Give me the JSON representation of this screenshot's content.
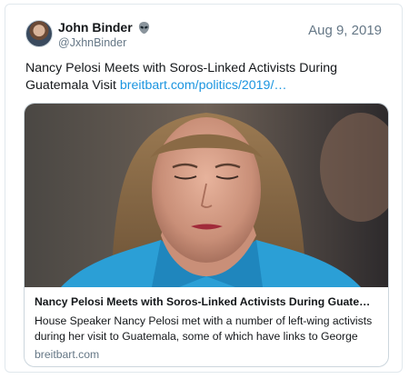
{
  "tweet": {
    "author_name": "John Binder",
    "author_handle": "@JxhnBinder",
    "date": "Aug 9, 2019",
    "text": "Nancy Pelosi Meets with Soros-Linked Activists During Guatemala Visit",
    "link_text": "breitbart.com/politics/2019/…",
    "name_icon": "alien-icon"
  },
  "card": {
    "title": "Nancy Pelosi Meets with Soros-Linked Activists During Guatemal…",
    "description": "House Speaker Nancy Pelosi met with a number of left-wing activists during her visit to Guatemala, some of which have links to George",
    "domain": "breitbart.com"
  },
  "colors": {
    "link": "#1b95e0",
    "muted": "#657786",
    "jacket": "#2b9fd6"
  }
}
